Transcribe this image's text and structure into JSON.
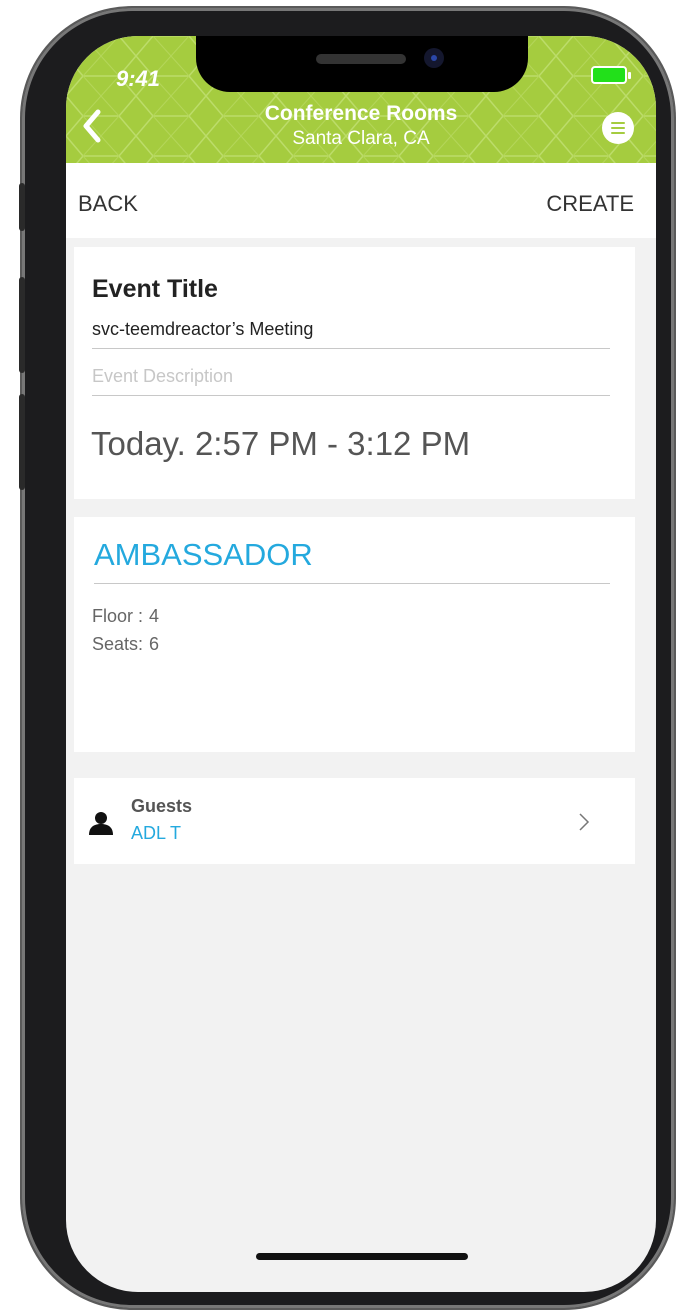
{
  "status_bar": {
    "time": "9:41"
  },
  "header": {
    "title": "Conference Rooms",
    "subtitle": "Santa Clara, CA",
    "accent_color": "#a5cc3f",
    "back_icon": "chevron-left-icon",
    "menu_icon": "menu-icon"
  },
  "toolbar": {
    "back_label": "BACK",
    "create_label": "CREATE"
  },
  "event": {
    "heading": "Event Title",
    "title_value": "svc-teemdreactor’s Meeting",
    "description_placeholder": "Event Description",
    "time_range": "Today. 2:57 PM - 3:12 PM"
  },
  "room": {
    "name": "AMBASSADOR",
    "name_color": "#24a9de",
    "floor_label": "Floor :",
    "floor_value": "4",
    "seats_label": "Seats:",
    "seats_value": "6"
  },
  "guests": {
    "label": "Guests",
    "value": "ADL T",
    "icon": "person-icon",
    "chevron_icon": "chevron-right-icon"
  }
}
